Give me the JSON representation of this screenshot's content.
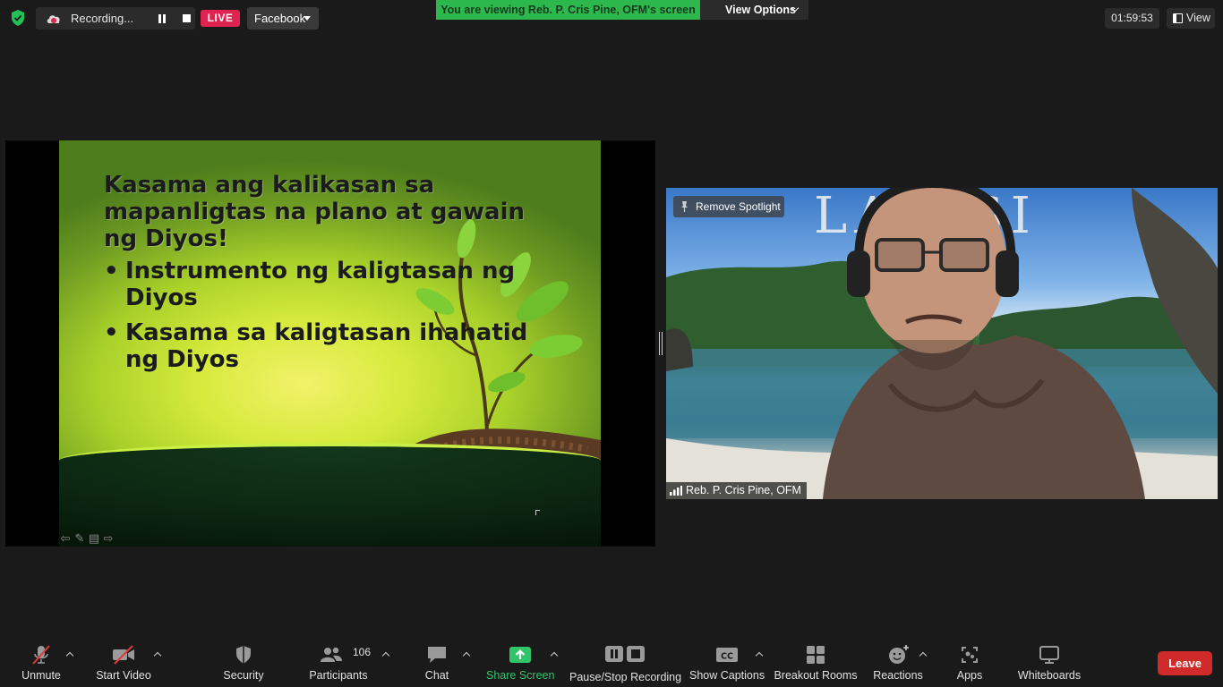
{
  "top_bar": {
    "recording_label": "Recording...",
    "live_label": "LIVE",
    "platform_label": "Facebook",
    "viewing_banner": "You are viewing Reb. P. Cris Pine, OFM's screen",
    "view_options_label": "View Options",
    "meeting_timer": "01:59:53",
    "view_label": "View"
  },
  "shared_slide": {
    "heading_lines": [
      "Kasama ang kalikasan sa",
      "mapanligtas na plano at gawain",
      "ng Diyos!"
    ],
    "bullets": [
      [
        "Instrumento ng kaligtasan ng",
        "Diyos"
      ],
      [
        "Kasama sa kaligtasan ihahatid",
        "ng Diyos"
      ]
    ]
  },
  "video_tile": {
    "spotlight_label": "Remove Spotlight",
    "participant_name": "Reb. P. Cris Pine, OFM",
    "background_overlay_text": "LA   OSI"
  },
  "toolbar": {
    "unmute_label": "Unmute",
    "start_video_label": "Start Video",
    "security_label": "Security",
    "participants_label": "Participants",
    "participants_count": "106",
    "chat_label": "Chat",
    "share_screen_label": "Share Screen",
    "recording_label": "Pause/Stop Recording",
    "captions_label": "Show Captions",
    "breakout_label": "Breakout Rooms",
    "reactions_label": "Reactions",
    "apps_label": "Apps",
    "whiteboards_label": "Whiteboards",
    "leave_label": "Leave",
    "cc_text": "CC"
  },
  "colors": {
    "background": "#1a1a1a",
    "live_red": "#e02350",
    "banner_green": "#2db84d",
    "share_green": "#31c46b",
    "leave_red": "#d12a2a",
    "mute_slash_red": "#e0393e"
  }
}
